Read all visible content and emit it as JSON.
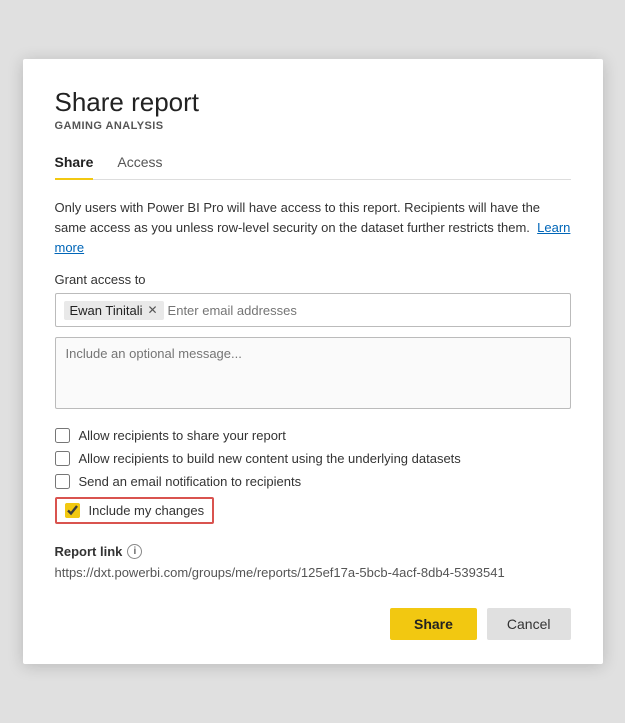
{
  "dialog": {
    "title": "Share report",
    "subtitle": "GAMING ANALYSIS",
    "tabs": [
      {
        "id": "share",
        "label": "Share",
        "active": true
      },
      {
        "id": "access",
        "label": "Access",
        "active": false
      }
    ],
    "info_text": "Only users with Power BI Pro will have access to this report. Recipients will have the same access as you unless row-level security on the dataset further restricts them.",
    "learn_more_label": "Learn more",
    "grant_access_label": "Grant access to",
    "email_tag_name": "Ewan Tinitali",
    "email_placeholder": "Enter email addresses",
    "message_placeholder": "Include an optional message...",
    "checkboxes": [
      {
        "id": "allow-share",
        "label": "Allow recipients to share your report",
        "checked": false
      },
      {
        "id": "allow-build",
        "label": "Allow recipients to build new content using the underlying datasets",
        "checked": false
      },
      {
        "id": "send-email",
        "label": "Send an email notification to recipients",
        "checked": false
      },
      {
        "id": "include-changes",
        "label": "Include my changes",
        "checked": true,
        "highlighted": true
      }
    ],
    "report_link": {
      "label": "Report link",
      "url": "https://dxt.powerbi.com/groups/me/reports/125ef17a-5bcb-4acf-8db4-5393541"
    },
    "buttons": {
      "share": "Share",
      "cancel": "Cancel"
    }
  }
}
